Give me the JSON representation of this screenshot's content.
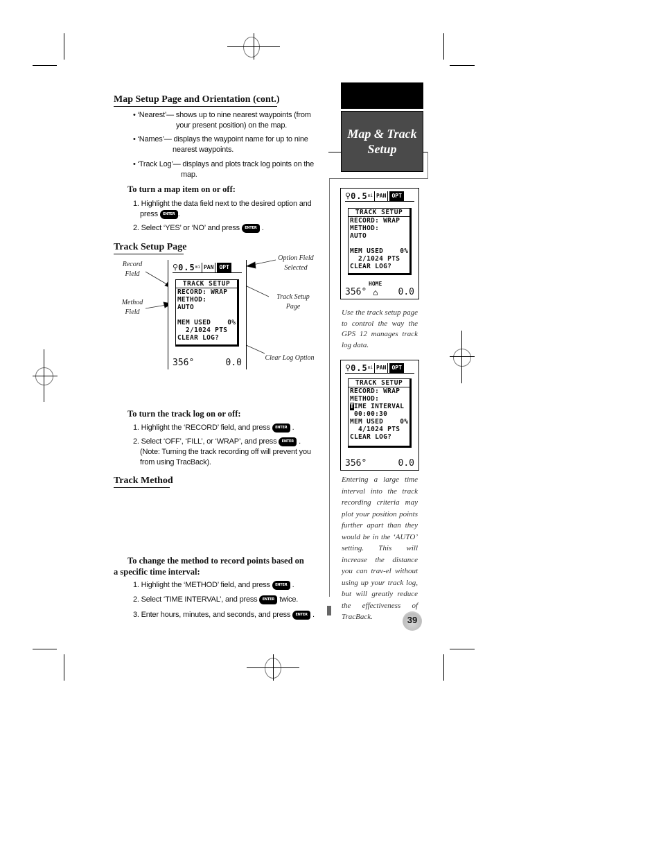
{
  "chapter_tab": {
    "title_line1": "Map & Track",
    "title_line2": "Setup"
  },
  "page_number": "39",
  "section_map_setup": {
    "title": "Map Setup Page and Orientation (cont.)",
    "bullets": [
      {
        "lead": "• ‘Nearest’— shows up to nine nearest waypoints (from",
        "cont": "your present position) on the map."
      },
      {
        "lead": "• ‘Names’— displays the waypoint name for up to nine",
        "cont": "nearest waypoints."
      },
      {
        "lead": "• ‘Track Log’— displays and plots track log points on the",
        "cont": "map."
      }
    ],
    "procedure_title": "To turn a map item on or off:",
    "steps": [
      {
        "text": "1. Highlight the data field next to the desired option and",
        "cont": "press",
        "key": "ENTER",
        "after": "."
      },
      {
        "text": "2. Select ‘YES’ or ‘NO’  and press",
        "key": "ENTER",
        "after": "."
      }
    ]
  },
  "section_track_setup": {
    "title": "Track Setup Page",
    "callouts": {
      "record_field": [
        "Record",
        "Field"
      ],
      "method_field": [
        "Method",
        "Field"
      ],
      "option_field": [
        "Option Field",
        "Selected"
      ],
      "track_setup_page": [
        "Track Setup",
        "Page"
      ],
      "clear_log": "Clear Log Option"
    },
    "procedure_title": "To turn the track log on or off:",
    "steps": [
      {
        "text": "1. Highlight the ‘RECORD’ field, and press",
        "key": "ENTER",
        "after": "."
      },
      {
        "text": "2. Select ‘OFF’, ‘FILL’, or ‘WRAP’, and press",
        "key": "ENTER",
        "after": ".",
        "note1": "(Note: Turning the track recording off will prevent you",
        "note2": "from using TracBack)."
      }
    ]
  },
  "section_track_method": {
    "title": "Track Method",
    "procedure_title_line1": "To change the method to record points based on",
    "procedure_title_line2": "a specific time interval:",
    "steps": [
      {
        "text": "1. Highlight the ‘METHOD’ field, and press",
        "key": "ENTER",
        "after": "."
      },
      {
        "text": "2. Select ‘TIME INTERVAL’, and press",
        "key": "ENTER",
        "after": "twice."
      },
      {
        "text": "3. Enter hours, minutes, and seconds, and press",
        "key": "ENTER",
        "after": "."
      }
    ]
  },
  "gps_screens": {
    "main": {
      "zoom_scale": "0.5",
      "scale_unit": "mi",
      "pan_label": "PAN",
      "opt_label": "OPT",
      "panel_title": "TRACK SETUP",
      "lines": [
        "RECORD: WRAP",
        "METHOD:",
        "AUTO",
        "",
        "MEM USED    0%",
        "  2/1024 PTS",
        "CLEAR LOG?"
      ],
      "heading": "356°",
      "speed": "0.0"
    },
    "side1": {
      "zoom_scale": "0.5",
      "scale_unit": "mi",
      "pan_label": "PAN",
      "opt_label": "OPT",
      "panel_title": "TRACK SETUP",
      "lines": [
        "RECORD: WRAP",
        "METHOD:",
        "AUTO",
        "",
        "MEM USED    0%",
        "  2/1024 PTS",
        "CLEAR LOG?"
      ],
      "home_label": "HOME",
      "heading": "356°",
      "speed": "0.0"
    },
    "side2": {
      "zoom_scale": "0.5",
      "scale_unit": "mi",
      "pan_label": "PAN",
      "opt_label": "OPT",
      "panel_title": "TRACK SETUP",
      "lines": [
        "RECORD: WRAP",
        "METHOD:",
        "IME INTERVAL",
        " 00:00:30",
        "MEM USED    0%",
        "  4/1024 PTS",
        "CLEAR LOG?"
      ],
      "cursor_char": "T",
      "heading": "356°",
      "speed": "0.0"
    }
  },
  "sidebar_captions": {
    "caption1": "Use the track setup page to control the way the GPS 12 manages track log data.",
    "caption2": "Entering a large time interval into the track recording criteria may plot your position points further apart than they would be in the ‘AUTO’ setting. This will increase the distance you can trav-el without using up your track log, but will greatly reduce the effectiveness of TracBack."
  }
}
